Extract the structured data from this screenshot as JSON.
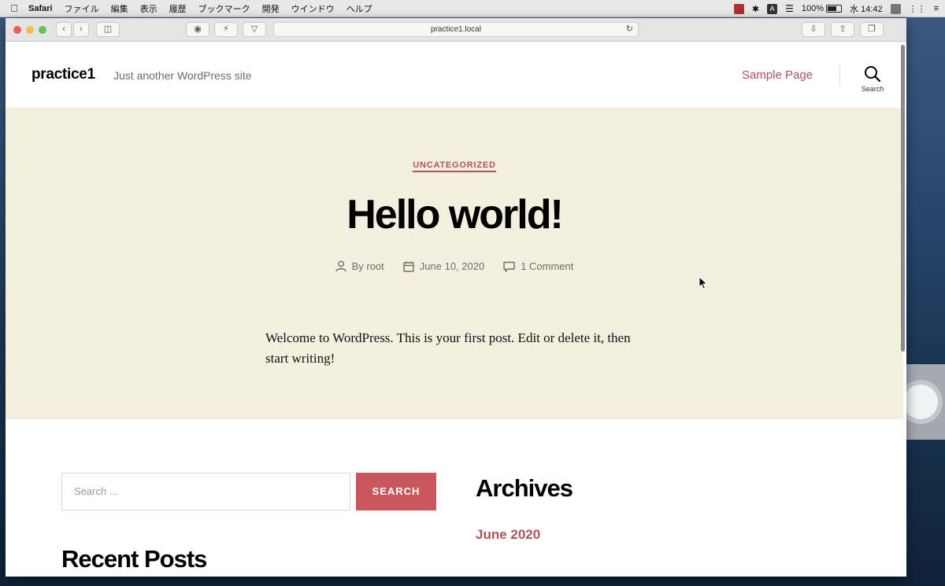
{
  "menubar": {
    "app": "Safari",
    "items": [
      "ファイル",
      "編集",
      "表示",
      "履歴",
      "ブックマーク",
      "開発",
      "ウインドウ",
      "ヘルプ"
    ],
    "battery": "100%",
    "clock": "水 14:42"
  },
  "browser": {
    "url": "practice1.local"
  },
  "site": {
    "title": "practice1",
    "description": "Just another WordPress site",
    "nav": [
      "Sample Page"
    ],
    "search_label": "Search"
  },
  "post": {
    "category": "UNCATEGORIZED",
    "title": "Hello world!",
    "author": "By root",
    "date": "June 10, 2020",
    "comments": "1 Comment",
    "content": "Welcome to WordPress. This is your first post. Edit or delete it, then start writing!"
  },
  "widgets": {
    "search_placeholder": "Search ...",
    "search_button": "SEARCH",
    "recent_posts_title": "Recent Posts",
    "archives_title": "Archives",
    "archive_items": [
      "June 2020"
    ]
  },
  "colors": {
    "accent": "#b0525c",
    "hero_background": "#f5efe0",
    "button": "#c9575d"
  }
}
